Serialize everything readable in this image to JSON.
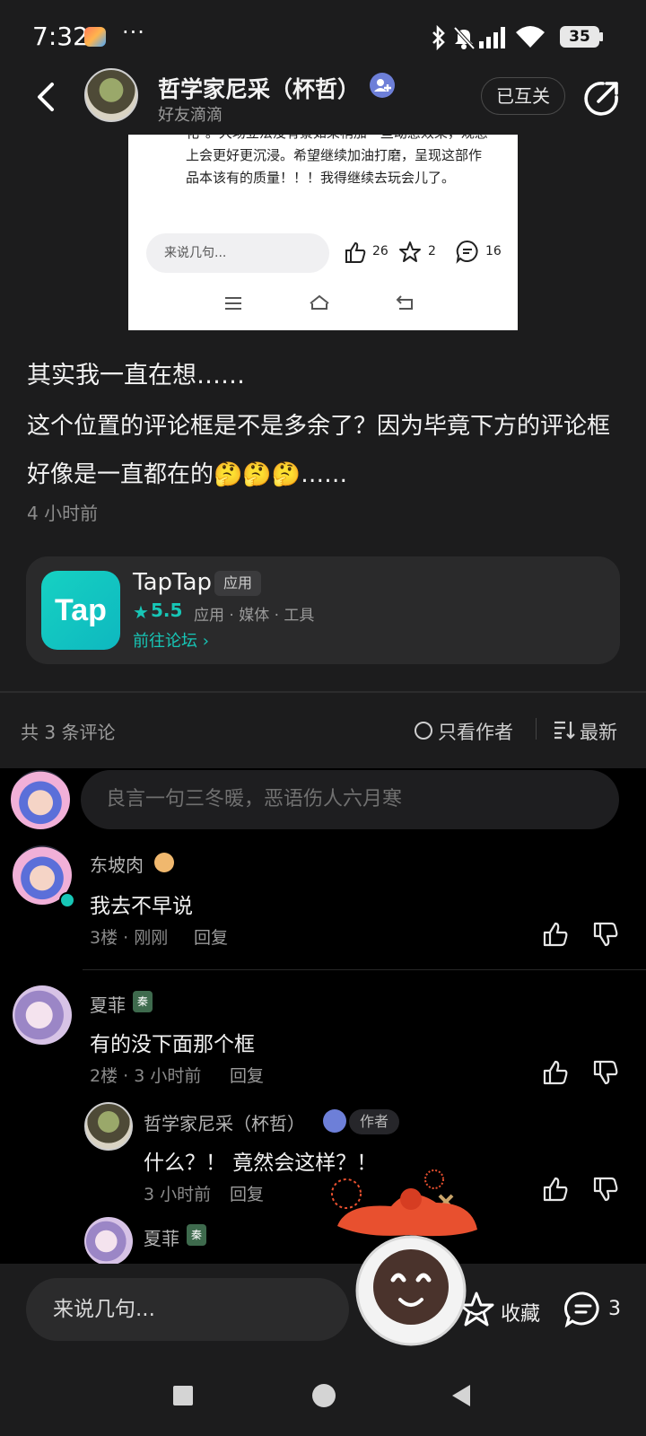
{
  "status_bar": {
    "time": "7:32",
    "more": "···",
    "battery": "35"
  },
  "header": {
    "author_name": "哲学家尼采（杯哲）",
    "subtitle": "好友滴滴",
    "follow_label": "已互关"
  },
  "embedded_screenshot": {
    "text": "化\"。大场立法没有景如果稍加一些动感效果，观感上会更好更沉浸。希望继续加油打磨，呈现这部作品本该有的质量！！！我得继续去玩会儿了。",
    "input_placeholder": "来说几句...",
    "likes": "26",
    "favorites": "2",
    "comments": "16"
  },
  "post": {
    "line1": "其实我一直在想……",
    "line2": "这个位置的评论框是不是多余了？因为毕竟下方的评论框好像是一直都在的🤔🤔🤔……",
    "time": "4 小时前"
  },
  "app_card": {
    "icon_text": "Tap",
    "name": "TapTap",
    "tag": "应用",
    "star": "★",
    "rating": "5.5",
    "categories": "应用 · 媒体 · 工具",
    "forum_link": "前往论坛 ›"
  },
  "comments_header": {
    "count": "共 3 条评论",
    "author_only": "只看作者",
    "sort": "最新"
  },
  "comment_input": {
    "placeholder": "良言一句三冬暖，恶语伤人六月寒"
  },
  "comments": [
    {
      "name": "东坡肉",
      "text": "我去不早说",
      "meta": "3楼 · 刚刚",
      "reply": "回复"
    },
    {
      "name": "夏菲",
      "badge": "秦",
      "text": "有的没下面那个框",
      "meta": "2楼 · 3 小时前",
      "reply": "回复"
    }
  ],
  "reply": {
    "name": "哲学家尼采（杯哲）",
    "author_tag": "作者",
    "text": "什么？！ 竟然会这样？！",
    "meta": "3 小时前",
    "reply": "回复"
  },
  "reply2": {
    "name": "夏菲",
    "badge": "秦"
  },
  "bottom_bar": {
    "input_placeholder": "来说几句...",
    "favorite_label": "收藏",
    "comment_count": "3"
  },
  "colors": {
    "accent": "#17c6b6",
    "background": "#1c1c1d",
    "comments_bg": "#000000"
  }
}
